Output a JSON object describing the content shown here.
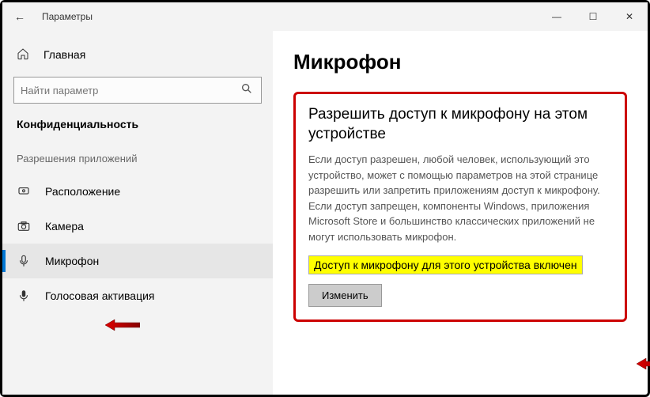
{
  "window": {
    "title": "Параметры",
    "minimize": "—",
    "maximize": "☐",
    "close": "✕"
  },
  "sidebar": {
    "home": "Главная",
    "search_placeholder": "Найти параметр",
    "section": "Конфиденциальность",
    "subsection": "Разрешения приложений",
    "items": [
      {
        "label": "Расположение"
      },
      {
        "label": "Камера"
      },
      {
        "label": "Микрофон"
      },
      {
        "label": "Голосовая активация"
      }
    ]
  },
  "main": {
    "heading": "Микрофон",
    "subheading": "Разрешить доступ к микрофону на этом устройстве",
    "description": "Если доступ разрешен, любой человек, использующий это устройство, может с помощью параметров на этой странице разрешить или запретить приложениям доступ к микрофону. Если доступ запрещен, компоненты Windows, приложения Microsoft Store и большинство классических приложений не могут использовать микрофон.",
    "status": "Доступ к микрофону для этого устройства включен",
    "change": "Изменить"
  }
}
